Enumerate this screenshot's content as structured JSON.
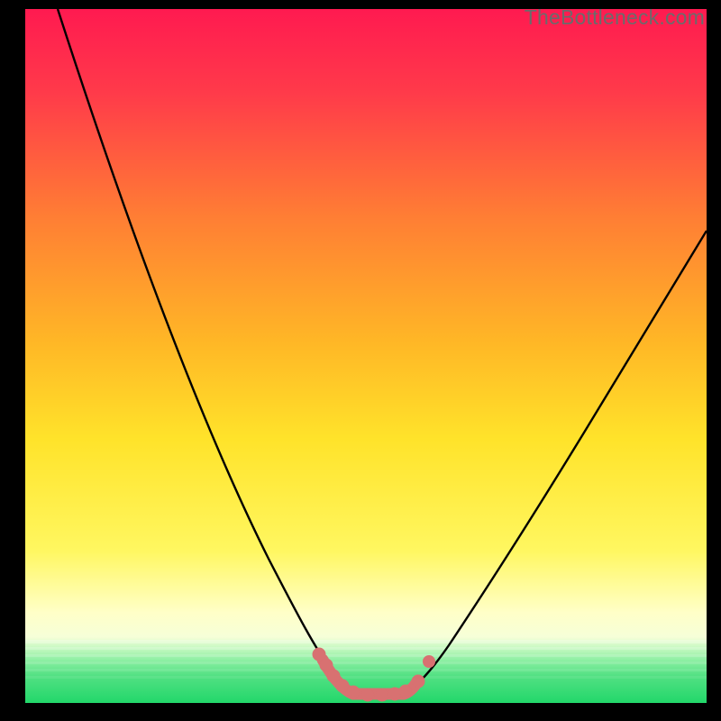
{
  "watermark": "TheBottleneck.com",
  "colors": {
    "black": "#000000",
    "curve": "#000000",
    "dots": "#d87171",
    "gradient_top": "#ff1a50",
    "gradient_mid_upper": "#ff8a2a",
    "gradient_mid": "#ffe52a",
    "gradient_pale": "#ffffc8",
    "gradient_green_top": "#7cf49a",
    "gradient_green": "#22d76a"
  },
  "chart_data": {
    "type": "line",
    "title": "",
    "xlabel": "",
    "ylabel": "",
    "xlim": [
      0,
      100
    ],
    "ylim": [
      0,
      100
    ],
    "x": [
      3,
      6,
      10,
      15,
      20,
      25,
      30,
      35,
      38,
      40,
      42,
      44,
      46,
      48,
      50,
      52,
      55,
      60,
      65,
      70,
      75,
      80,
      85,
      90,
      95,
      100
    ],
    "series": [
      {
        "name": "bottleneck-curve",
        "values": [
          100,
          90,
          80,
          70,
          60,
          50,
          40,
          30,
          20,
          14,
          8,
          4,
          2,
          1,
          1,
          2,
          5,
          12,
          20,
          28,
          35,
          42,
          48,
          54,
          58,
          62
        ]
      }
    ],
    "marker_region": {
      "x": [
        40,
        42,
        44,
        46,
        48,
        50,
        52,
        54,
        56
      ],
      "values": [
        14,
        8,
        4,
        2,
        1,
        1,
        2,
        4,
        7
      ]
    },
    "annotations": []
  }
}
